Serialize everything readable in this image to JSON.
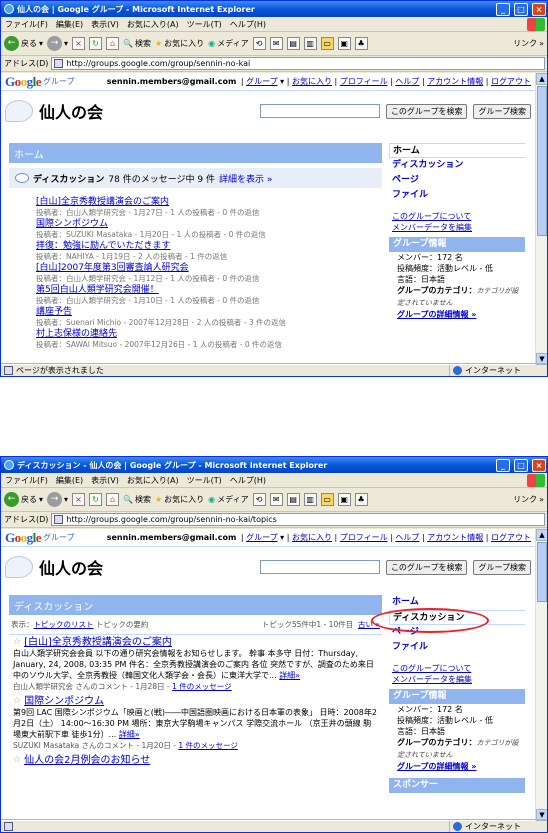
{
  "window1": {
    "title": "仙人の会 | Google グループ - Microsoft Internet Explorer",
    "address": "http://groups.google.com/group/sennin-no-kai",
    "status": "ページが表示されました"
  },
  "window2": {
    "title": "ディスカッション - 仙人の会 | Google グループ - Microsoft Internet Explorer",
    "address": "http://groups.google.com/group/sennin-no-kai/topics",
    "status": ""
  },
  "menu": [
    "ファイル(F)",
    "編集(E)",
    "表示(V)",
    "お気に入り(A)",
    "ツール(T)",
    "ヘルプ(H)"
  ],
  "toolbar": {
    "back": "戻る",
    "search": "検索",
    "favorites": "お気に入り",
    "media": "メディア",
    "links": "リンク"
  },
  "address_label": "アドレス(D)",
  "internet_zone": "インターネット",
  "google": {
    "logo": [
      "G",
      "o",
      "o",
      "g",
      "l",
      "e"
    ],
    "logo_colors": [
      "#2a5bd7",
      "#d62d20",
      "#f4b400",
      "#2a5bd7",
      "#008744",
      "#d62d20"
    ],
    "groups": "グループ",
    "user": "sennin.members@gmail.com",
    "links": [
      "グループ",
      "お気に入り",
      "プロフィール",
      "ヘルプ",
      "アカウント情報",
      "ログアウト"
    ],
    "sep": "|"
  },
  "group": {
    "name": "仙人の会",
    "search_group_button": "このグループを検索",
    "search_groups_button": "グループ検索"
  },
  "sidebar": {
    "home": "ホーム",
    "discussions": "ディスカッション",
    "pages": "ページ",
    "files": "ファイル",
    "about": "このグループについて",
    "edit_member_data": "メンバーデータを編集",
    "info_title": "グループ情報",
    "members": "メンバー：172 名",
    "activity": "投稿頻度：活動レベル - 低",
    "language": "言語：日本語",
    "category_label": "グループのカテゴリ：",
    "category_value": "カテゴリが設定されていません",
    "details_link": "グループの詳細情報 »",
    "sponsor": "スポンサー"
  },
  "page1": {
    "header": "ホーム",
    "discussion_label": "ディスカッション",
    "discussion_count": "78 件のメッセージ中 9 件",
    "show_details": "詳細を表示 »",
    "topics": [
      {
        "title": "[白山]全京秀教授講演会のご案内",
        "meta": "投稿者：白山人類学研究会 - 1月27日 - 1 人の投稿者 - 0 件の返信"
      },
      {
        "title": "国際シンポジウム",
        "meta": "投稿者：SUZUKI Masataka - 1月20日 - 1 人の投稿者 - 0 件の返信"
      },
      {
        "title": "拝復：勉強に励んでいただきます",
        "meta": "投稿者：NAHIYA - 1月19日 - 2 人の投稿者 - 1 件の返信"
      },
      {
        "title": "[白山]2007年度第3回審査論人研究会",
        "meta": "投稿者：白山人類学研究会 - 1月12日 - 1 人の投稿者 - 0 件の返信"
      },
      {
        "title": "第5回白山人類学研究会開催！",
        "meta": "投稿者：白山人類学研究会 - 1月10日 - 1 人の投稿者 - 0 件の返信"
      },
      {
        "title": "講座予告",
        "meta": "投稿者：Suenari Michio - 2007年12月28日 - 2 人の投稿者 - 3 件の返信"
      },
      {
        "title": "村上志保様の連絡先",
        "meta": "投稿者：SAWAI Mitsuo - 2007年12月26日 - 1 人の投稿者 - 0 件の返信"
      }
    ]
  },
  "page2": {
    "header": "ディスカッション",
    "view_label": "表示：",
    "view_list": "トピックのリスト",
    "view_summary": "トピックの要約",
    "range": "トピック55件中1 - 10件目",
    "newer": "古い »",
    "posts": [
      {
        "title": "[白山]全京秀教授講演会のご案内",
        "body": "白山人類学研究会会員 以下の通り研究会情報をお知らせします。 幹事 本多守 日付：Thursday, January, 24, 2008, 03:35 PM 件名：全京秀教授講演会のご案内 各位 突然ですが、調査のため来日中のソウル大学、全京秀教授（韓国文化人類学会・会長）に東洋大学で...",
        "more": "詳細»",
        "meta": "白山人類学研究会 さんのコメント - 1月28日 - ",
        "msgs": "1 件のメッセージ"
      },
      {
        "title": "国際シンポジウム",
        "body": "第9回 LAC 国際シンポジウム「映画と(戦)――中国語圏映画における日本軍の表象」 日時：2008年2月2日（土） 14:00～16:30 PM 場所：東京大学駒場キャンパス 学際交流ホール （京王井の頭線 駒場東大前駅下車 徒歩1分）...",
        "more": "詳細»",
        "meta": "SUZUKI Masataka さんのコメント - 1月20日 - ",
        "msgs": "1 件のメッセージ"
      },
      {
        "title": "仙人の会2月例会のお知らせ",
        "body": "",
        "more": "",
        "meta": "",
        "msgs": ""
      }
    ]
  }
}
